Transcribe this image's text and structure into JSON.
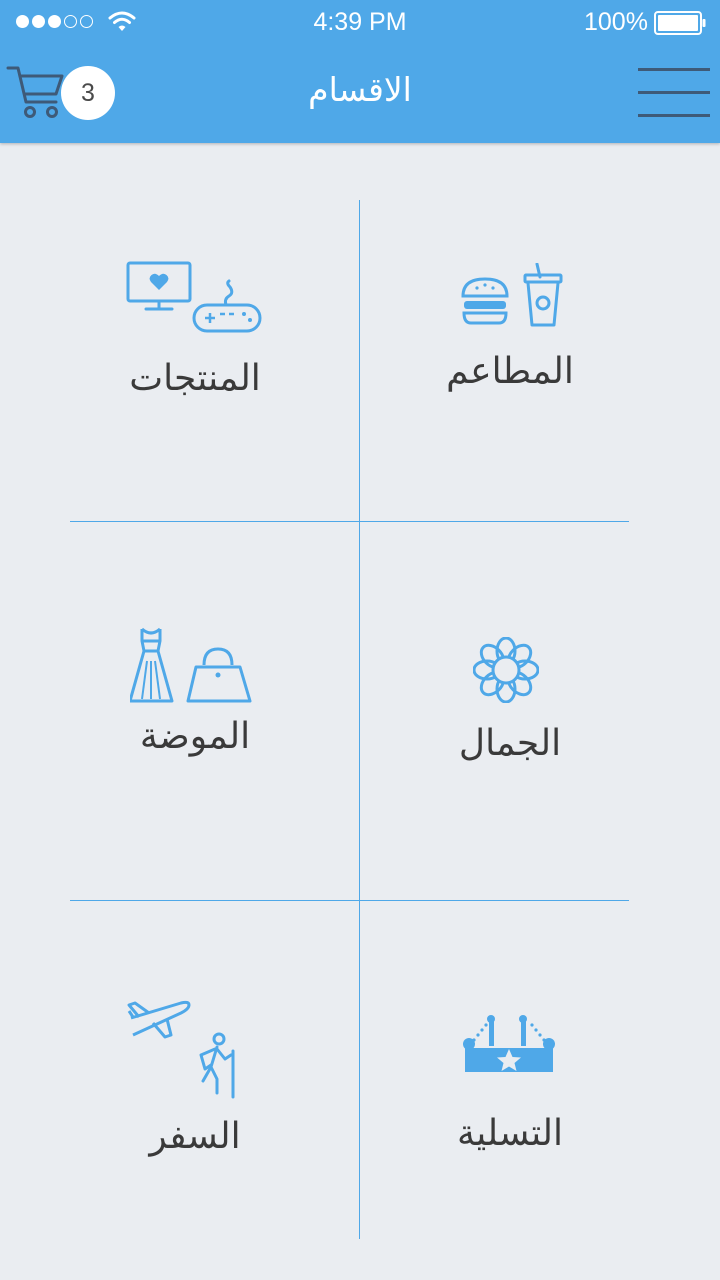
{
  "status_bar": {
    "time": "4:39 PM",
    "battery_percent": "100%",
    "signal_bars": 3,
    "signal_total": 5,
    "icons": [
      "signal-dots-icon",
      "wifi-icon",
      "battery-icon"
    ]
  },
  "nav": {
    "title": "الاقسام",
    "cart_count": "3",
    "icons": [
      "cart-icon",
      "hamburger-menu-icon"
    ]
  },
  "categories": [
    {
      "label": "المطاعم",
      "icon": "food-drink-icon"
    },
    {
      "label": "المنتجات",
      "icon": "electronics-gamepad-icon"
    },
    {
      "label": "الجمال",
      "icon": "flower-icon"
    },
    {
      "label": "الموضة",
      "icon": "dress-handbag-icon"
    },
    {
      "label": "التسلية",
      "icon": "entertainment-stage-icon"
    },
    {
      "label": "السفر",
      "icon": "plane-hiker-icon"
    }
  ],
  "colors": {
    "accent": "#4fa8e8",
    "background": "#eaedf1",
    "text": "#3a3a3a",
    "menu_lines": "#3e5a78"
  }
}
